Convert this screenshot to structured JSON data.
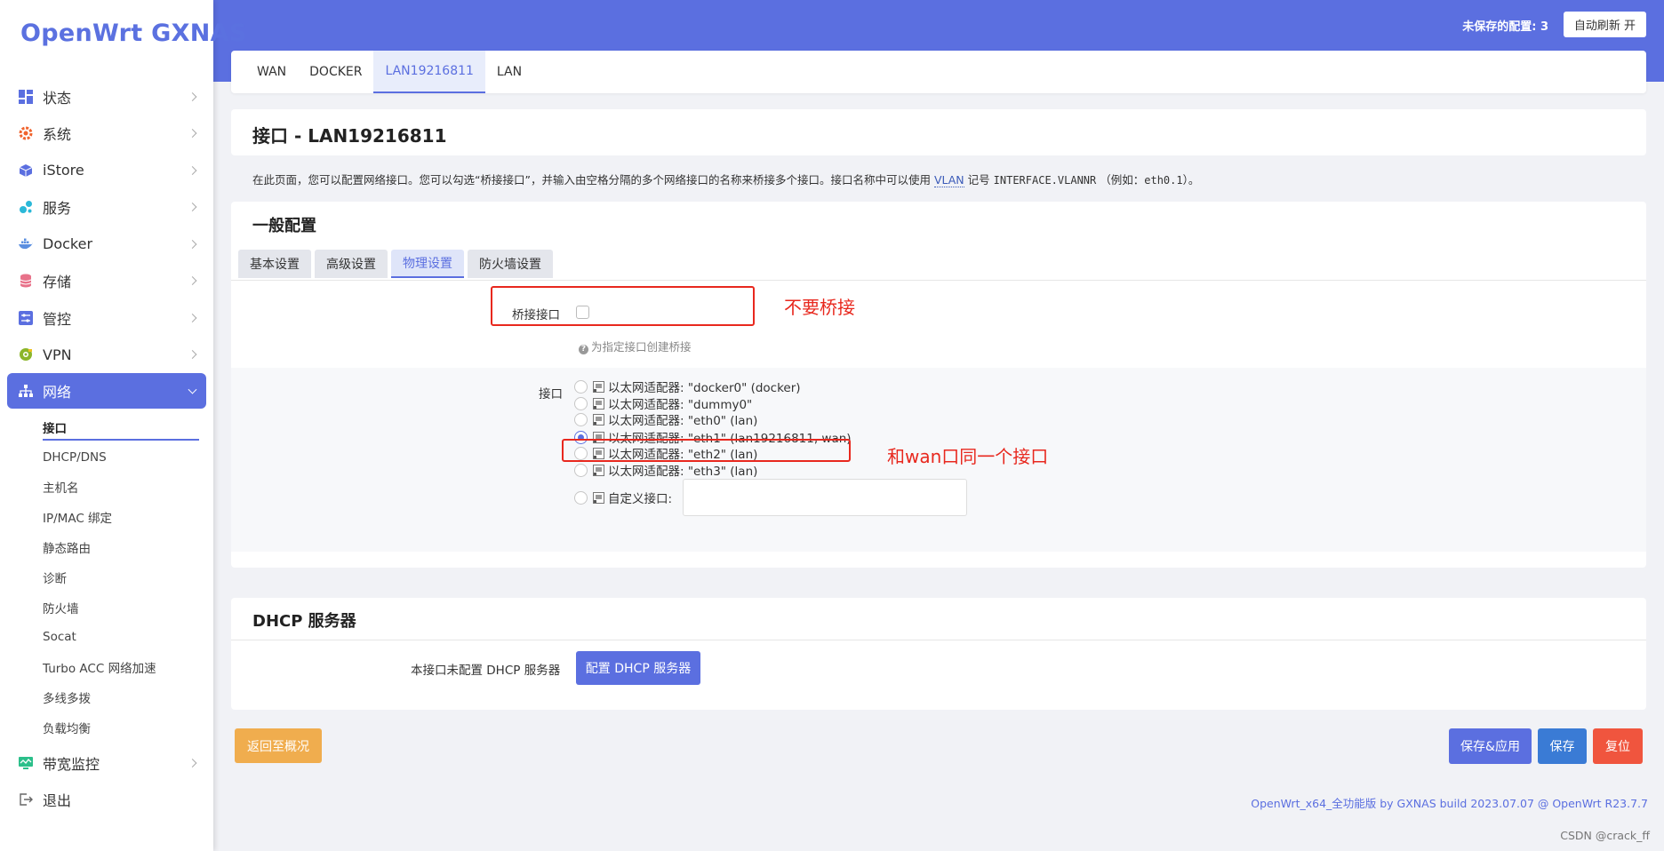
{
  "app": {
    "logo": "OpenWrt GXNAS",
    "unsaved": "未保存的配置: 3",
    "refresh_button": "自动刷新 开"
  },
  "sidebar": {
    "items": [
      {
        "label": "状态",
        "icon": "dashboard-icon",
        "color": "#5b6fe0"
      },
      {
        "label": "系统",
        "icon": "gear-icon",
        "color": "#f0632d"
      },
      {
        "label": "iStore",
        "icon": "cube-icon",
        "color": "#5b6fe0"
      },
      {
        "label": "服务",
        "icon": "puzzle-icon",
        "color": "#2bb8d8"
      },
      {
        "label": "Docker",
        "icon": "docker-icon",
        "color": "#5b8fe0"
      },
      {
        "label": "存储",
        "icon": "database-icon",
        "color": "#e8728a"
      },
      {
        "label": "管控",
        "icon": "sliders-icon",
        "color": "#5b6fe0"
      },
      {
        "label": "VPN",
        "icon": "vpn-icon",
        "color": "#8bb52a"
      },
      {
        "label": "网络",
        "icon": "network-icon",
        "color": "#ffffff"
      }
    ],
    "network_submenu": [
      "接口",
      "DHCP/DNS",
      "主机名",
      "IP/MAC 绑定",
      "静态路由",
      "诊断",
      "防火墙",
      "Socat",
      "Turbo ACC 网络加速",
      "多线多拨",
      "负载均衡"
    ],
    "bottom_items": [
      {
        "label": "带宽监控",
        "icon": "monitor-icon",
        "color": "#2bbf8a"
      },
      {
        "label": "退出",
        "icon": "logout-icon",
        "color": "#666666"
      }
    ]
  },
  "iface_tabs": [
    "WAN",
    "DOCKER",
    "LAN19216811",
    "LAN"
  ],
  "page": {
    "title": "接口 - LAN19216811",
    "desc_1": "在此页面，您可以配置网络接口。您可以勾选“桥接接口”，并输入由空格分隔的多个网络接口的名称来桥接多个接口。接口名称中可以使用",
    "desc_vlan": "VLAN",
    "desc_2": "记号",
    "desc_code": "INTERFACE.VLANNR",
    "desc_3": "（例如：",
    "desc_example": "eth0.1",
    "desc_4": "）。"
  },
  "general": {
    "title": "一般配置",
    "tabs": [
      "基本设置",
      "高级设置",
      "物理设置",
      "防火墙设置"
    ],
    "bridge_label": "桥接接口",
    "bridge_hint": "为指定接口创建桥接",
    "iface_label": "接口",
    "options": [
      "以太网适配器: \"docker0\" (docker)",
      "以太网适配器: \"dummy0\"",
      "以太网适配器: \"eth0\" (lan)",
      "以太网适配器: \"eth1\" (lan19216811, wan)",
      "以太网适配器: \"eth2\" (lan)",
      "以太网适配器: \"eth3\" (lan)"
    ],
    "selected_index": 3,
    "custom_label": "自定义接口:"
  },
  "dhcp": {
    "title": "DHCP 服务器",
    "note": "本接口未配置 DHCP 服务器",
    "button": "配置 DHCP 服务器"
  },
  "actions": {
    "back": "返回至概况",
    "save_apply": "保存&应用",
    "save": "保存",
    "reset": "复位"
  },
  "footer": "OpenWrt_x64_全功能版 by GXNAS build 2023.07.07 @ OpenWrt R23.7.7",
  "watermark": "CSDN @crack_ff",
  "annotations": {
    "bridge_note": "不要桥接",
    "iface_note": "和wan口同一个接口"
  }
}
